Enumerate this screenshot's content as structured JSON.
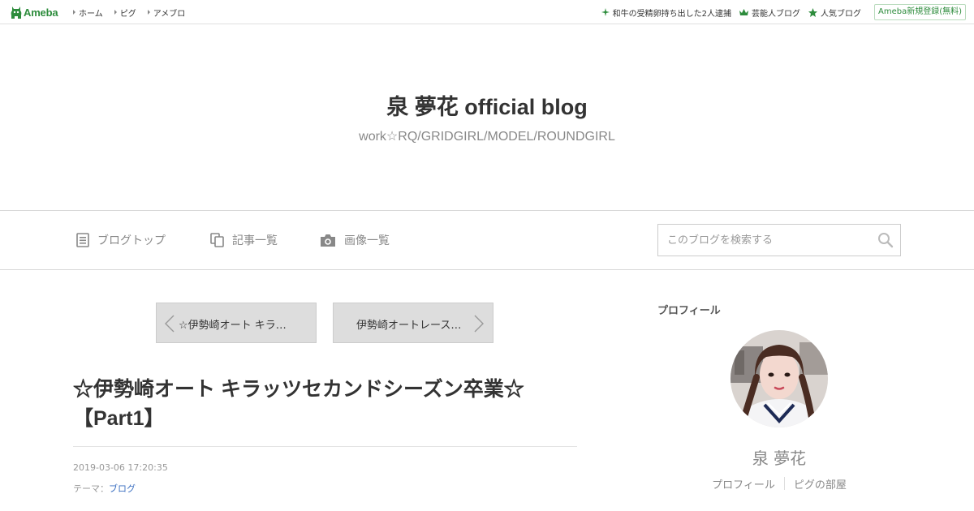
{
  "topbar": {
    "logo_text": "Ameba",
    "nav": [
      {
        "label": "ホーム"
      },
      {
        "label": "ピグ"
      },
      {
        "label": "アメブロ"
      }
    ],
    "links": [
      {
        "label": "和牛の受精卵持ち出した2人逮捕",
        "icon": "sparkle-icon"
      },
      {
        "label": "芸能人ブログ",
        "icon": "crown-icon"
      },
      {
        "label": "人気ブログ",
        "icon": "star-icon"
      }
    ],
    "register_label": "Ameba新規登録(無料)"
  },
  "header": {
    "title": "泉 夢花 official blog",
    "subtitle": "work☆RQ/GRIDGIRL/MODEL/ROUNDGIRL"
  },
  "nav": {
    "items": [
      {
        "label": "ブログトップ",
        "icon": "document-icon"
      },
      {
        "label": "記事一覧",
        "icon": "copy-icon"
      },
      {
        "label": "画像一覧",
        "icon": "camera-icon"
      }
    ],
    "search_placeholder": "このブログを検索する"
  },
  "pager": {
    "prev_label": "☆伊勢崎オート キラ…",
    "next_label": "伊勢崎オートレース…"
  },
  "entry": {
    "title": "☆伊勢崎オート キラッツセカンドシーズン卒業☆【Part1】",
    "date": "2019-03-06 17:20:35",
    "theme_prefix": "テーマ：",
    "theme_label": "ブログ"
  },
  "sidebar": {
    "heading": "プロフィール",
    "name": "泉 夢花",
    "links": [
      {
        "label": "プロフィール"
      },
      {
        "label": "ピグの部屋"
      }
    ]
  },
  "colors": {
    "brand_green": "#2d8c3c",
    "link_blue": "#3a6ec0"
  }
}
